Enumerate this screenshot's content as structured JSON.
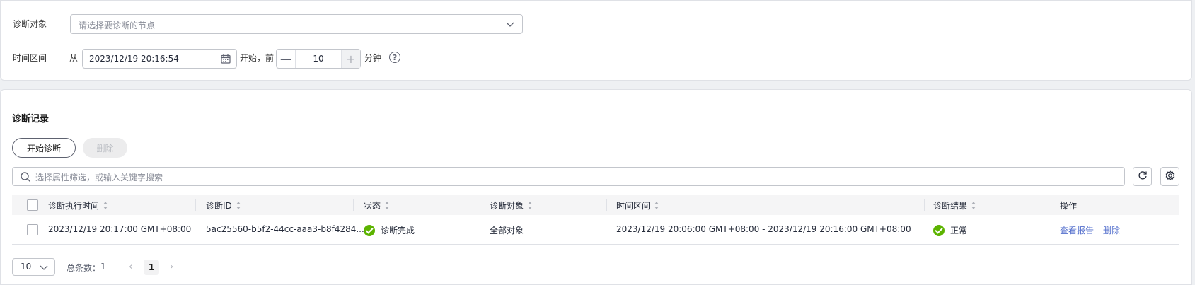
{
  "filter": {
    "target_label": "诊断对象",
    "target_placeholder": "请选择要诊断的节点",
    "time_label": "时间区间",
    "from_label": "从",
    "date_value": "2023/12/19 20:16:54",
    "start_suffix": "开始，前",
    "minus_glyph": "—",
    "plus_glyph": "+",
    "minutes_value": "10",
    "unit_label": "分钟",
    "help_glyph": "?"
  },
  "records": {
    "title": "诊断记录",
    "start_button": "开始诊断",
    "delete_button": "删除",
    "search_placeholder": "选择属性筛选，或输入关键字搜索"
  },
  "table": {
    "headers": [
      "诊断执行时间",
      "诊断ID",
      "状态",
      "诊断对象",
      "时间区间",
      "诊断结果",
      "操作"
    ],
    "rows": [
      {
        "exec_time": "2023/12/19 20:17:00 GMT+08:00",
        "id": "5ac25560-b5f2-44cc-aaa3-b8f4284...",
        "status": "诊断完成",
        "target": "全部对象",
        "range": "2023/12/19 20:06:00 GMT+08:00 - 2023/12/19 20:16:00 GMT+08:00",
        "result": "正常",
        "action_view": "查看报告",
        "action_delete": "删除"
      }
    ]
  },
  "pagination": {
    "page_size": "10",
    "total_label": "总条数：",
    "total_value": "1",
    "prev_glyph": "‹",
    "next_glyph": "›",
    "current_page": "1"
  },
  "colors": {
    "success": "#5cb300",
    "link": "#526ecc"
  },
  "icons": [
    "chevron-down-icon",
    "calendar-icon",
    "help-icon",
    "search-icon",
    "refresh-icon",
    "settings-icon",
    "success-icon"
  ]
}
